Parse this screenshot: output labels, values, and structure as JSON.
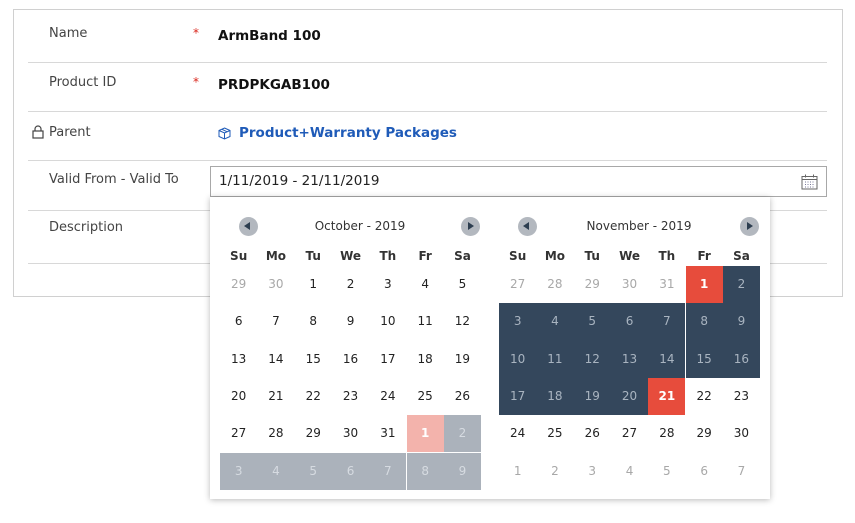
{
  "form": {
    "fields": [
      {
        "label": "Name",
        "required": true,
        "value": "ArmBand 100"
      },
      {
        "label": "Product ID",
        "required": true,
        "value": "PRDPKGAB100"
      },
      {
        "label": "Parent",
        "locked": true,
        "link": "Product+Warranty Packages",
        "icon": "product-box-icon"
      },
      {
        "label": "Valid From - Valid To",
        "value": "1/11/2019 - 21/11/2019",
        "icon": "calendar-icon"
      },
      {
        "label": "Description",
        "value": ""
      }
    ],
    "required_marker": "*"
  },
  "datepicker": {
    "weekdays": [
      "Su",
      "Mo",
      "Tu",
      "We",
      "Th",
      "Fr",
      "Sa"
    ],
    "range_start": "1/11/2019",
    "range_end": "21/11/2019",
    "colors": {
      "selected": "#e74c3c",
      "range": "#34475c",
      "range_preview": "#abb2bb",
      "selected_preview": "#f3b3ac"
    },
    "months": [
      {
        "title": "October - 2019",
        "days": [
          [
            29,
            30,
            1,
            2,
            3,
            4,
            5
          ],
          [
            6,
            7,
            8,
            9,
            10,
            11,
            12
          ],
          [
            13,
            14,
            15,
            16,
            17,
            18,
            19
          ],
          [
            20,
            21,
            22,
            23,
            24,
            25,
            26
          ],
          [
            27,
            28,
            29,
            30,
            31,
            1,
            2
          ],
          [
            3,
            4,
            5,
            6,
            7,
            8,
            9
          ]
        ],
        "other_month": [
          [
            0,
            0
          ],
          [
            0,
            1
          ],
          [
            4,
            5
          ],
          [
            4,
            6
          ],
          [
            5,
            0
          ],
          [
            5,
            1
          ],
          [
            5,
            2
          ],
          [
            5,
            3
          ],
          [
            5,
            4
          ],
          [
            5,
            5
          ],
          [
            5,
            6
          ]
        ],
        "selected_light": [
          [
            4,
            5
          ]
        ],
        "range_light": [
          [
            4,
            6
          ],
          [
            5,
            0
          ],
          [
            5,
            1
          ],
          [
            5,
            2
          ],
          [
            5,
            3
          ],
          [
            5,
            4
          ],
          [
            5,
            5
          ],
          [
            5,
            6
          ]
        ],
        "selected": [],
        "range": []
      },
      {
        "title": "November - 2019",
        "days": [
          [
            27,
            28,
            29,
            30,
            31,
            1,
            2
          ],
          [
            3,
            4,
            5,
            6,
            7,
            8,
            9
          ],
          [
            10,
            11,
            12,
            13,
            14,
            15,
            16
          ],
          [
            17,
            18,
            19,
            20,
            21,
            22,
            23
          ],
          [
            24,
            25,
            26,
            27,
            28,
            29,
            30
          ],
          [
            1,
            2,
            3,
            4,
            5,
            6,
            7
          ]
        ],
        "other_month": [
          [
            0,
            0
          ],
          [
            0,
            1
          ],
          [
            0,
            2
          ],
          [
            0,
            3
          ],
          [
            0,
            4
          ],
          [
            5,
            0
          ],
          [
            5,
            1
          ],
          [
            5,
            2
          ],
          [
            5,
            3
          ],
          [
            5,
            4
          ],
          [
            5,
            5
          ],
          [
            5,
            6
          ]
        ],
        "selected_light": [],
        "range_light": [],
        "selected": [
          [
            0,
            5
          ],
          [
            3,
            4
          ]
        ],
        "range": [
          [
            0,
            6
          ],
          [
            1,
            0
          ],
          [
            1,
            1
          ],
          [
            1,
            2
          ],
          [
            1,
            3
          ],
          [
            1,
            4
          ],
          [
            1,
            5
          ],
          [
            1,
            6
          ],
          [
            2,
            0
          ],
          [
            2,
            1
          ],
          [
            2,
            2
          ],
          [
            2,
            3
          ],
          [
            2,
            4
          ],
          [
            2,
            5
          ],
          [
            2,
            6
          ],
          [
            3,
            0
          ],
          [
            3,
            1
          ],
          [
            3,
            2
          ],
          [
            3,
            3
          ]
        ]
      }
    ]
  }
}
